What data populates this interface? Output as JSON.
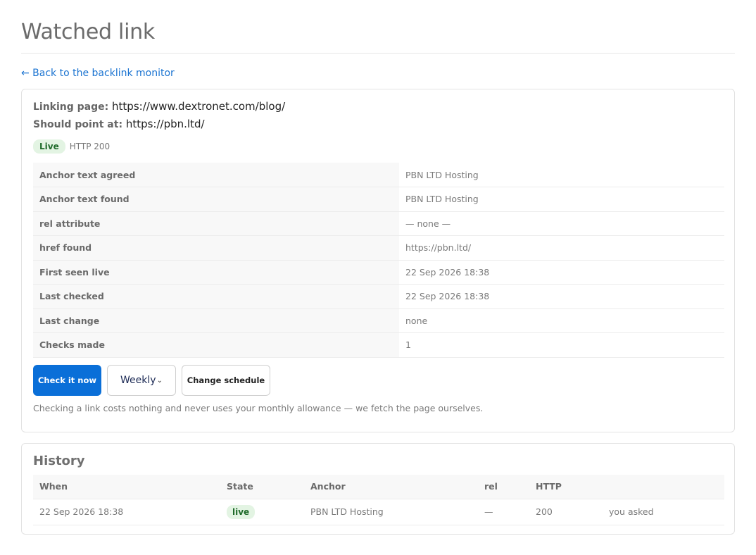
{
  "page": {
    "title": "Watched link",
    "back_link": "← Back to the backlink monitor"
  },
  "link": {
    "linking_page_label": "Linking page:",
    "linking_page_value": "https://www.dextronet.com/blog/",
    "should_point_label": "Should point at:",
    "should_point_value": "https://pbn.ltd/",
    "status_badge": "Live",
    "http_status": "HTTP 200"
  },
  "details": [
    {
      "label": "Anchor text agreed",
      "value": "PBN LTD Hosting"
    },
    {
      "label": "Anchor text found",
      "value": "PBN LTD Hosting"
    },
    {
      "label": "rel attribute",
      "value": "— none —"
    },
    {
      "label": "href found",
      "value": "https://pbn.ltd/"
    },
    {
      "label": "First seen live",
      "value": "22 Sep 2026 18:38"
    },
    {
      "label": "Last checked",
      "value": "22 Sep 2026 18:38"
    },
    {
      "label": "Last change",
      "value": "none"
    },
    {
      "label": "Checks made",
      "value": "1"
    }
  ],
  "actions": {
    "check_now_label": "Check it now",
    "frequency_selected": "Weekly",
    "change_schedule_label": "Change schedule",
    "note": "Checking a link costs nothing and never uses your monthly allowance — we fetch the page ourselves."
  },
  "history": {
    "title": "History",
    "headers": [
      "When",
      "State",
      "Anchor",
      "rel",
      "HTTP",
      ""
    ],
    "rows": [
      {
        "when": "22 Sep 2026 18:38",
        "state": "live",
        "anchor": "PBN LTD Hosting",
        "rel": "—",
        "http": "200",
        "source": "you asked"
      }
    ]
  },
  "colors": {
    "accent": "#0a6fd8",
    "link": "#1a73d1",
    "live_badge_bg": "#e3f4e3",
    "live_badge_text": "#1f6b2a"
  },
  "icons": {
    "frequency_dropdown": "chevron-down-icon"
  }
}
